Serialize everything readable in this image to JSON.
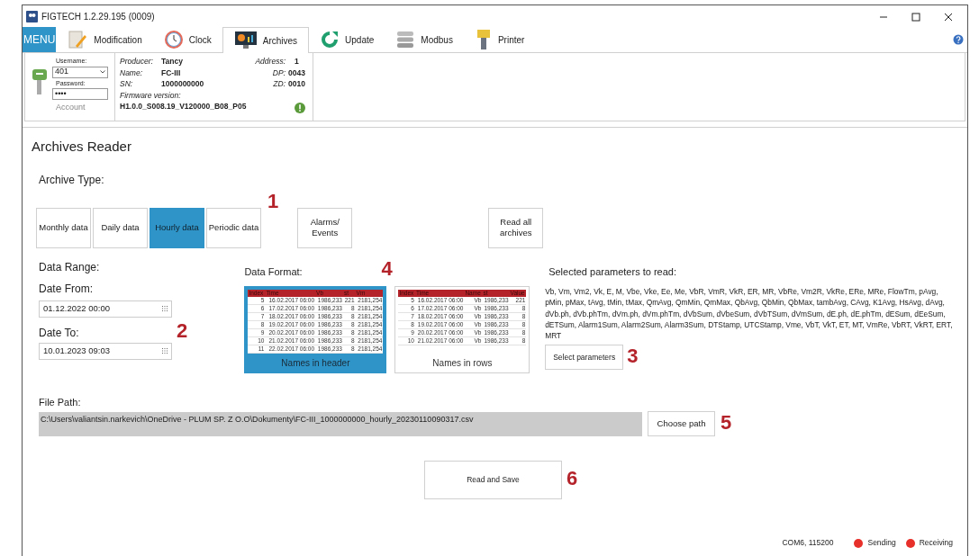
{
  "window": {
    "title": "FIGTECH 1.2.29.195 (0009)"
  },
  "menu_button": "MENU",
  "tabs": [
    {
      "label": "Modification",
      "selected": false
    },
    {
      "label": "Clock",
      "selected": false
    },
    {
      "label": "Archives",
      "selected": true
    },
    {
      "label": "Update",
      "selected": false
    },
    {
      "label": "Modbus",
      "selected": false
    },
    {
      "label": "Printer",
      "selected": false
    }
  ],
  "account": {
    "username_label": "Username:",
    "username": "401",
    "password_label": "Password:",
    "password": "••••",
    "caption": "Account"
  },
  "device": {
    "producer_label": "Producer:",
    "producer": "Tancy",
    "name_label": "Name:",
    "name": "FC-III",
    "sn_label": "SN:",
    "sn": "1000000000",
    "firmware_label": "Firmware version:",
    "firmware": "H1.0.0_S008.19_V120000_B08_P05",
    "address_label": "Address:",
    "address": "1",
    "dp_label": "DP:",
    "dp": "0043",
    "zd_label": "ZD:",
    "zd": "0010"
  },
  "page_title": "Archives Reader",
  "archive_type": {
    "label": "Archive Type:",
    "options": [
      {
        "label": "Monthly data",
        "selected": false
      },
      {
        "label": "Daily data",
        "selected": false
      },
      {
        "label": "Hourly data",
        "selected": true
      },
      {
        "label": "Periodic data",
        "selected": false
      }
    ],
    "callout": "1",
    "alarms_button": "Alarms/\nEvents",
    "read_all_button": "Read all\narchives"
  },
  "data_range": {
    "label": "Data Range:",
    "from_label": "Date From:",
    "from": "01.12.2022 00:00",
    "to_label": "Date To:",
    "to": "10.01.2023 09:03",
    "callout": "2"
  },
  "data_format": {
    "label": "Data Format:",
    "callout": "4",
    "options": [
      {
        "caption": "Names in header",
        "selected": true,
        "columns": [
          "Index",
          "Time",
          "Vb",
          "st",
          "Vm"
        ],
        "rows": [
          [
            "5",
            "16.02.2017 06:00",
            "1986,233",
            "221",
            "2181,254"
          ],
          [
            "6",
            "17.02.2017 06:00",
            "1986,233",
            "8",
            "2181,254"
          ],
          [
            "7",
            "18.02.2017 06:00",
            "1986,233",
            "8",
            "2181,254"
          ],
          [
            "8",
            "19.02.2017 06:00",
            "1986,233",
            "8",
            "2181,254"
          ],
          [
            "9",
            "20.02.2017 06:00",
            "1986,233",
            "8",
            "2181,254"
          ],
          [
            "10",
            "21.02.2017 06:00",
            "1986,233",
            "8",
            "2181,254"
          ],
          [
            "11",
            "22.02.2017 06:00",
            "1986,233",
            "8",
            "2181,254"
          ]
        ]
      },
      {
        "caption": "Names in rows",
        "selected": false,
        "columns": [
          "Index",
          "Time",
          "Name",
          "st",
          "Value"
        ],
        "rows": [
          [
            "5",
            "16.02.2017 06:00",
            "Vb",
            "1986,233",
            "221"
          ],
          [
            "6",
            "17.02.2017 06:00",
            "Vb",
            "1986,233",
            "8"
          ],
          [
            "7",
            "18.02.2017 06:00",
            "Vb",
            "1986,233",
            "8"
          ],
          [
            "8",
            "19.02.2017 06:00",
            "Vb",
            "1986,233",
            "8"
          ],
          [
            "9",
            "20.02.2017 06:00",
            "Vb",
            "1986,233",
            "8"
          ],
          [
            "10",
            "21.02.2017 06:00",
            "Vb",
            "1986,233",
            "8"
          ]
        ]
      }
    ]
  },
  "parameters": {
    "label": "Selected parameters to read:",
    "list": "Vb, Vm, Vm2, Vk, E, M, Vbe, Vke, Ee, Me, VbR, VmR, VkR, ER, MR, VbRe, Vm2R, VkRe, ERe, MRe, FlowTm, pAvg, pMin, pMax, tAvg, tMin, tMax, QmAvg, QmMin, QmMax, QbAvg, QbMin, QbMax, tambAvg, CAvg, K1Avg, HsAvg, dAvg, dVb.ph, dVb.phTm, dVm.ph, dVm.phTm, dVbSum, dVbeSum, dVbTSum, dVmSum, dE.ph, dE.phTm, dESum, dEeSum, dETSum, Alarm1Sum, Alarm2Sum, Alarm3Sum, DTStamp, UTCStamp, Vme, VbT, VkT, ET, MT, VmRe, VbRT, VkRT, ERT, MRT",
    "button": "Select parameters",
    "callout": "3"
  },
  "file_path": {
    "label": "File Path:",
    "value": "C:\\Users\\valiantsin.narkevich\\OneDrive - PLUM SP. Z O.O\\Dokumenty\\FC-III_1000000000_hourly_20230110090317.csv",
    "button": "Choose path",
    "callout": "5"
  },
  "read_and_save": {
    "button": "Read and Save",
    "callout": "6"
  },
  "status_bar": {
    "port": "COM6, 115200",
    "indicators": [
      {
        "label": "Sending",
        "color": "#e8302a"
      },
      {
        "label": "Receiving",
        "color": "#e8302a"
      }
    ]
  }
}
